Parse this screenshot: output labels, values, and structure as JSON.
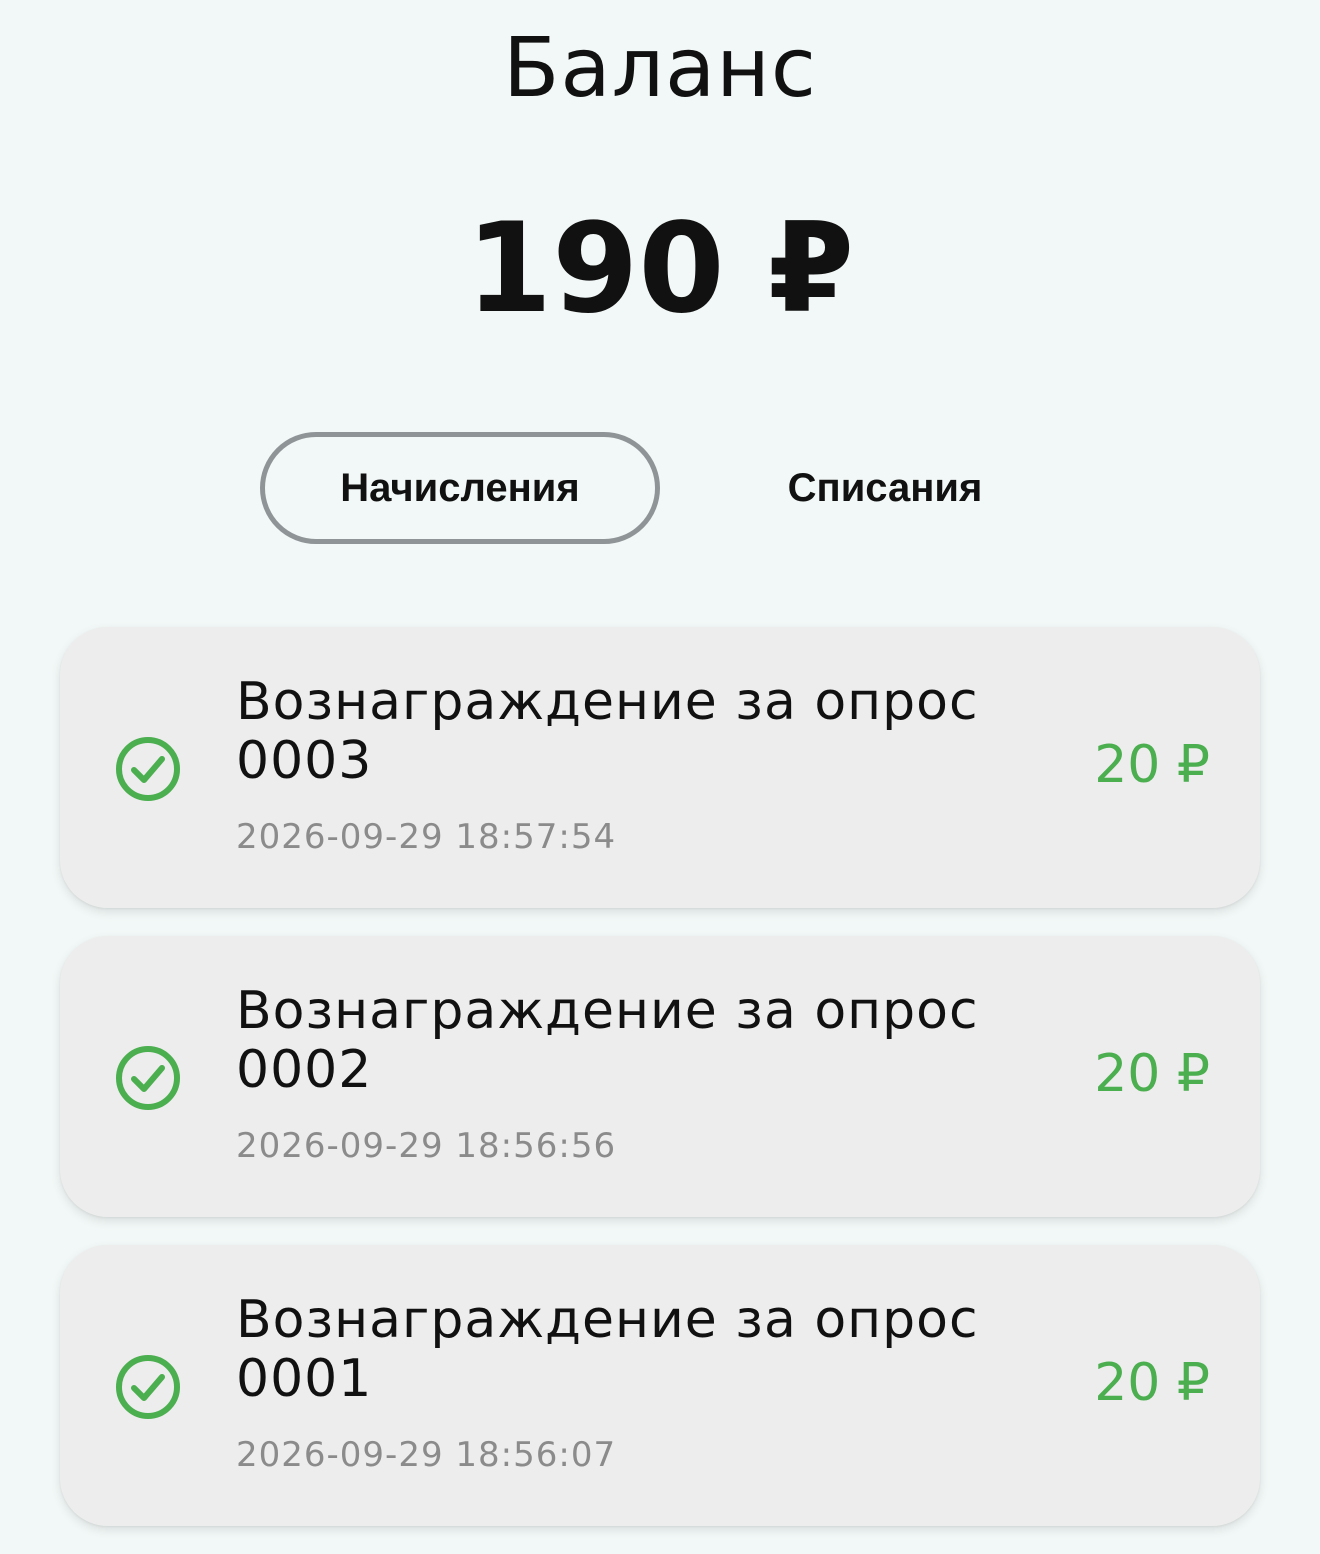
{
  "header": {
    "title": "Баланс",
    "balance": "190 ₽"
  },
  "tabs": [
    {
      "label": "Начисления",
      "active": true
    },
    {
      "label": "Списания",
      "active": false
    }
  ],
  "transactions": [
    {
      "title": "Вознаграждение за опрос 0003",
      "date": "2026-09-29 18:57:54",
      "amount": "20 ₽",
      "icon": "check-circle-icon"
    },
    {
      "title": "Вознаграждение за опрос 0002",
      "date": "2026-09-29 18:56:56",
      "amount": "20 ₽",
      "icon": "check-circle-icon"
    },
    {
      "title": "Вознаграждение за опрос 0001",
      "date": "2026-09-29 18:56:07",
      "amount": "20 ₽",
      "icon": "check-circle-icon"
    }
  ],
  "colors": {
    "background": "#F2F8F7",
    "card": "#EDEDED",
    "accent_green": "#4BAE4F",
    "tab_border": "#8F9597",
    "date_text": "#8B8B8B"
  }
}
